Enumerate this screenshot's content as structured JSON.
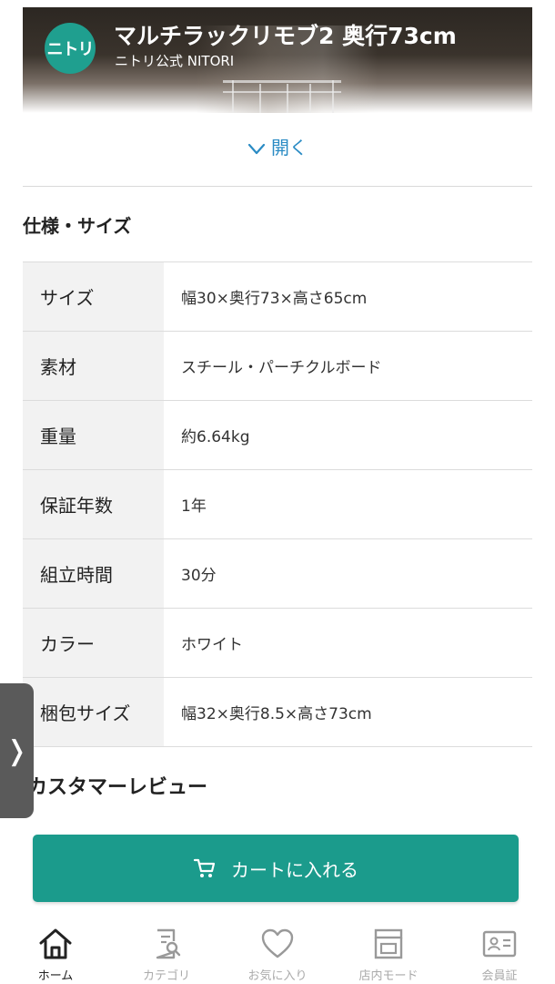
{
  "header": {
    "logo_text": "ニトリ",
    "title": "マルチラックリモブ2 奥行73cm",
    "subtitle": "ニトリ公式 NITORI"
  },
  "expand": {
    "label": "開く"
  },
  "specs": {
    "title": "仕様・サイズ",
    "rows": [
      {
        "key": "サイズ",
        "value": "幅30×奥行73×高さ65cm"
      },
      {
        "key": "素材",
        "value": "スチール・パーチクルボード"
      },
      {
        "key": "重量",
        "value": "約6.64kg"
      },
      {
        "key": "保証年数",
        "value": "1年"
      },
      {
        "key": "組立時間",
        "value": "30分"
      },
      {
        "key": "カラー",
        "value": "ホワイト"
      },
      {
        "key": "梱包サイズ",
        "value": "幅32×奥行8.5×高さ73cm"
      }
    ]
  },
  "reviews": {
    "title": "カスタマーレビュー"
  },
  "side_tab": {
    "icon": "chevron-right-icon",
    "glyph": "❭"
  },
  "cart": {
    "label": "カートに入れる",
    "icon": "cart-icon"
  },
  "nav": {
    "items": [
      {
        "label": "ホーム",
        "icon": "home-icon",
        "active": true
      },
      {
        "label": "カテゴリ",
        "icon": "category-search-icon",
        "active": false
      },
      {
        "label": "お気に入り",
        "icon": "heart-icon",
        "active": false
      },
      {
        "label": "店内モード",
        "icon": "store-icon",
        "active": false
      },
      {
        "label": "会員証",
        "icon": "member-card-icon",
        "active": false
      }
    ]
  },
  "colors": {
    "brand": "#1b9b8c",
    "link": "#2a8bc4",
    "table_key_bg": "#f2f2f2"
  }
}
